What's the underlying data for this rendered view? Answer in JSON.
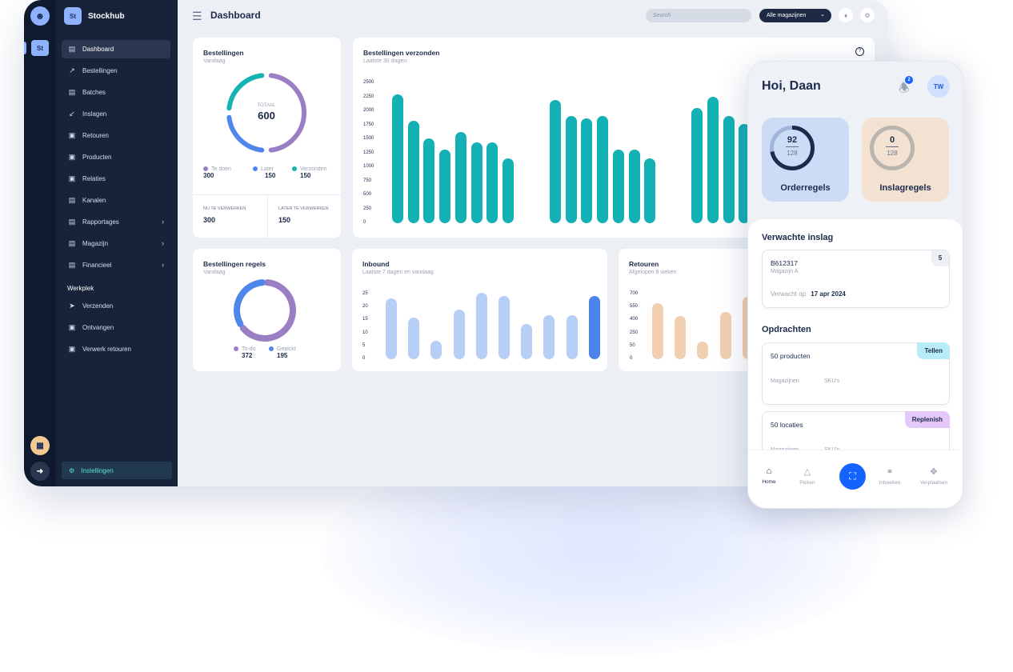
{
  "app": {
    "brand_short": "St",
    "brand_name": "Stockhub"
  },
  "rail": {
    "logout_icon": "logout-icon",
    "building_icon": "building-icon"
  },
  "sidebar": {
    "items": [
      {
        "label": "Dashboard",
        "icon": "dashboard-icon",
        "active": true
      },
      {
        "label": "Bestellingen",
        "icon": "arrow-up-right-icon"
      },
      {
        "label": "Batches",
        "icon": "batches-icon"
      },
      {
        "label": "Inslagen",
        "icon": "arrow-down-left-icon"
      },
      {
        "label": "Retouren",
        "icon": "returns-icon"
      },
      {
        "label": "Producten",
        "icon": "box-icon"
      },
      {
        "label": "Relaties",
        "icon": "contacts-icon"
      },
      {
        "label": "Kanalen",
        "icon": "channels-icon"
      },
      {
        "label": "Rapportages",
        "icon": "chart-icon",
        "chevron": true
      },
      {
        "label": "Magazijn",
        "icon": "warehouse-icon",
        "chevron": true
      },
      {
        "label": "Financieel",
        "icon": "card-icon",
        "chevron": true
      }
    ],
    "section_label": "Werkplek",
    "work_items": [
      {
        "label": "Verzenden",
        "icon": "send-icon"
      },
      {
        "label": "Ontvangen",
        "icon": "inbox-icon"
      },
      {
        "label": "Verwerk retouren",
        "icon": "returns-icon"
      }
    ],
    "settings_label": "Instellingen"
  },
  "topbar": {
    "title": "Dashboard",
    "search_placeholder": "Search",
    "warehouse_select": "Alle magazijnen"
  },
  "cards": {
    "orders": {
      "title": "Bestellingen",
      "subtitle": "Vandaag",
      "total_label": "TOTAAL",
      "total_value": "600",
      "legend": [
        {
          "label": "Te doen",
          "value": "300",
          "color": "#9b7ec4"
        },
        {
          "label": "Later",
          "value": "150",
          "color": "#4f86ec"
        },
        {
          "label": "Verzonden",
          "value": "150",
          "color": "#16b3b3"
        }
      ],
      "now_label": "NU TE VERWERKEN",
      "now_value": "300",
      "later_label": "LATER TE VERWERKEN",
      "later_value": "150"
    },
    "order_lines": {
      "title": "Bestellingen regels",
      "subtitle": "Vandaag",
      "legend": [
        {
          "label": "To-do",
          "value": "372",
          "color": "#9b7ec4"
        },
        {
          "label": "Gepickt",
          "value": "195",
          "color": "#4f86ec"
        }
      ]
    },
    "shipped": {
      "title": "Bestellingen verzonden",
      "subtitle": "Laatste 30 dagen",
      "help_icon": "help-icon"
    },
    "inbound": {
      "title": "Inbound",
      "subtitle": "Laatste 7 dagen en vandaag"
    },
    "returns": {
      "title": "Retouren",
      "subtitle": "Afgelopen 9 weken"
    }
  },
  "chart_data": [
    {
      "type": "bar",
      "title": "Bestellingen verzonden",
      "yticks": [
        "2500",
        "2250",
        "2000",
        "1750",
        "1500",
        "1250",
        "1000",
        "750",
        "500",
        "250",
        "0"
      ],
      "ylim": [
        0,
        2500
      ],
      "values": [
        2300,
        1830,
        1510,
        1320,
        1630,
        1440,
        1440,
        1160,
        null,
        null,
        2200,
        1920,
        1870,
        1910,
        1320,
        1320,
        1160,
        null,
        null,
        2060,
        2260,
        1910,
        1770,
        1800,
        1820
      ],
      "color": "#13b0b4"
    },
    {
      "type": "bar",
      "title": "Inbound",
      "yticks": [
        "25",
        "20",
        "15",
        "10",
        "5",
        "0"
      ],
      "ylim": [
        0,
        25
      ],
      "values": [
        23.5,
        16,
        7,
        19,
        25.5,
        24.5,
        13.5,
        17,
        17,
        24.5
      ],
      "colors": [
        "#b7cef6",
        "#b7cef6",
        "#b7cef6",
        "#b7cef6",
        "#b7cef6",
        "#b7cef6",
        "#b7cef6",
        "#b7cef6",
        "#b7cef6",
        "#4c83ea"
      ]
    },
    {
      "type": "bar",
      "title": "Retouren",
      "yticks": [
        "700",
        "550",
        "400",
        "250",
        "50",
        "0"
      ],
      "values": [
        6.5,
        5,
        2,
        5.5,
        7.2
      ],
      "ylim": [
        0,
        7.5
      ],
      "color": "#f2cfb0"
    },
    {
      "type": "pie",
      "title": "Bestellingen",
      "slices": [
        {
          "label": "Te doen",
          "value": 300,
          "color": "#9b7ec4"
        },
        {
          "label": "Later",
          "value": 150,
          "color": "#4f86ec"
        },
        {
          "label": "Verzonden",
          "value": 150,
          "color": "#16b3b3"
        }
      ]
    },
    {
      "type": "pie",
      "title": "Bestellingen regels",
      "slices": [
        {
          "label": "To-do",
          "value": 372,
          "color": "#9b7ec4"
        },
        {
          "label": "Gepickt",
          "value": 195,
          "color": "#4f86ec"
        }
      ]
    }
  ],
  "mobile": {
    "greeting": "Hoi, Daan",
    "notification_count": "2",
    "avatar": "TW",
    "order_lines": {
      "value": "92",
      "total": "128",
      "label": "Orderregels",
      "progress": 0.72
    },
    "inslag_lines": {
      "value": "0",
      "total": "128",
      "label": "Inslagregels",
      "progress": 0
    },
    "expected_title": "Verwachte inslag",
    "expected": {
      "code": "B612317",
      "warehouse": "Magazijn A",
      "count": "5",
      "expected_label": "Verwacht op",
      "expected_date": "17 apr 2024"
    },
    "tasks_title": "Opdrachten",
    "tasks": [
      {
        "title": "50 producten",
        "badge": "Tellen",
        "badge_color": "#b8ecf6",
        "meta1": "Magazijnen",
        "meta2": "SKU's"
      },
      {
        "title": "50 locaties",
        "badge": "Replenish",
        "badge_color": "#e5c8fb",
        "meta1": "Magazijnen",
        "meta2": "SKU's"
      }
    ],
    "tabs": [
      {
        "label": "Home",
        "icon": "home-icon",
        "active": true
      },
      {
        "label": "Picken",
        "icon": "pick-icon"
      },
      {
        "label": "",
        "icon": "scan-icon"
      },
      {
        "label": "Inboeken",
        "icon": "link-icon"
      },
      {
        "label": "Verplaatsen",
        "icon": "move-icon"
      }
    ]
  }
}
